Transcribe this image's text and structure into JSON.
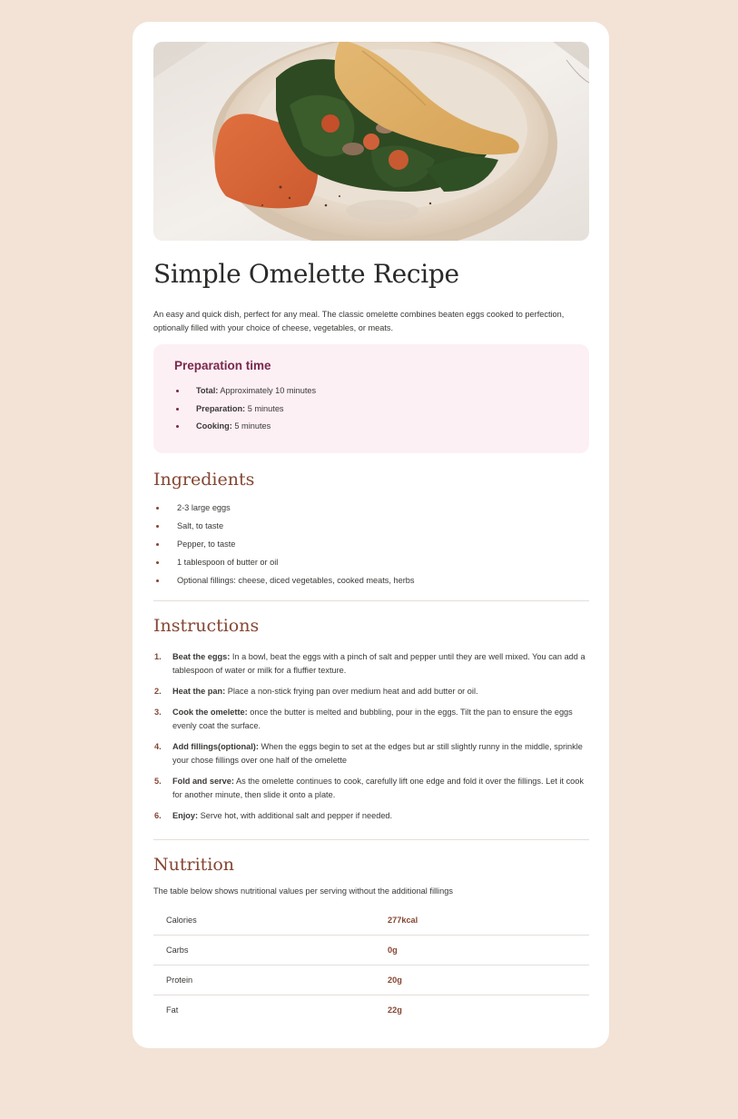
{
  "recipe": {
    "title": "Simple Omelette Recipe",
    "intro": "An easy and quick dish, perfect for any meal. The classic omelette combines beaten eggs cooked to perfection, optionally filled with your choice of cheese, vegetables, or meats."
  },
  "prep": {
    "title": "Preparation time",
    "items": [
      {
        "label": "Total:",
        "value": "Approximately 10 minutes"
      },
      {
        "label": "Preparation:",
        "value": "5 minutes"
      },
      {
        "label": "Cooking:",
        "value": "5 minutes"
      }
    ]
  },
  "ingredients": {
    "title": "Ingredients",
    "items": [
      "2-3 large eggs",
      "Salt, to taste",
      "Pepper, to taste",
      "1 tablespoon of butter or oil",
      "Optional fillings: cheese, diced vegetables, cooked meats, herbs"
    ]
  },
  "instructions": {
    "title": "Instructions",
    "steps": [
      {
        "num": "1.",
        "label": "Beat the eggs:",
        "text": "In a bowl, beat the eggs with a pinch of salt and pepper until they are well mixed. You can add a tablespoon of water or milk for a fluffier texture."
      },
      {
        "num": "2.",
        "label": "Heat the pan:",
        "text": "Place a non-stick frying pan over medium heat and add butter or oil."
      },
      {
        "num": "3.",
        "label": "Cook the omelette:",
        "text": "once the butter is melted and bubbling, pour in the eggs. Tilt the pan to ensure the eggs evenly coat the surface."
      },
      {
        "num": "4.",
        "label": "Add fillings(optional):",
        "text": "When the eggs begin to set at the edges but ar still slightly runny in the middle, sprinkle your chose fillings over one half of the omelette"
      },
      {
        "num": "5.",
        "label": "Fold and serve:",
        "text": "As the omelette continues to cook, carefully lift one edge and fold it over the fillings. Let it cook for another minute, then slide it onto a plate."
      },
      {
        "num": "6.",
        "label": "Enjoy:",
        "text": "Serve hot, with additional salt and pepper if needed."
      }
    ]
  },
  "nutrition": {
    "title": "Nutrition",
    "description": "The table below shows nutritional values per serving without the additional fillings",
    "rows": [
      {
        "name": "Calories",
        "value": "277kcal"
      },
      {
        "name": "Carbs",
        "value": "0g"
      },
      {
        "name": "Protein",
        "value": "20g"
      },
      {
        "name": "Fat",
        "value": "22g"
      }
    ]
  },
  "colors": {
    "background": "#f2e3d6",
    "heading_brown": "#854632",
    "prep_accent": "#7a284c",
    "prep_background": "#fdf0f5"
  }
}
